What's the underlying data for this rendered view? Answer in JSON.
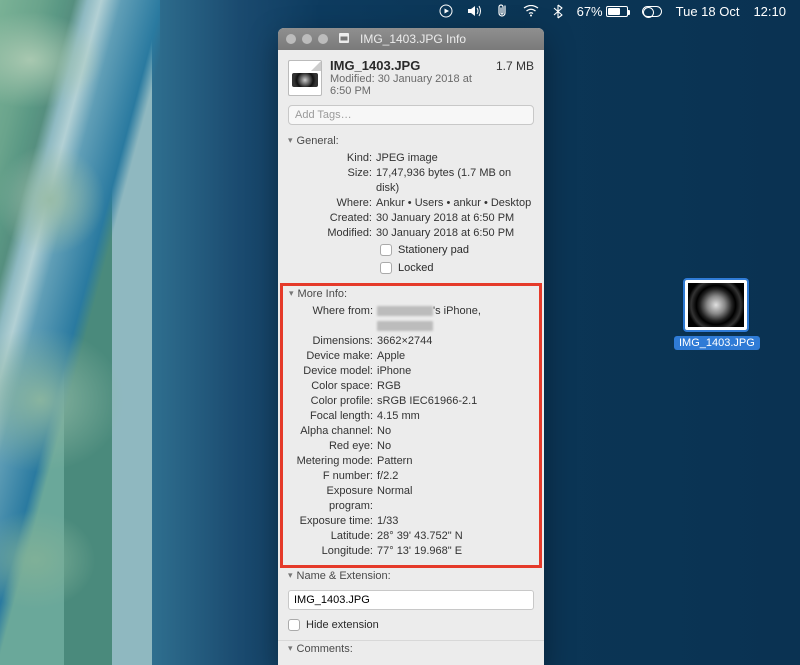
{
  "menubar": {
    "battery_pct": "67%",
    "date": "Tue 18 Oct",
    "time": "12:10"
  },
  "desktop_file": {
    "name": "IMG_1403.JPG"
  },
  "window": {
    "title": "IMG_1403.JPG Info",
    "header": {
      "filename": "IMG_1403.JPG",
      "size": "1.7 MB",
      "modified": "Modified: 30 January 2018 at 6:50 PM"
    },
    "tags_placeholder": "Add Tags…",
    "sections": {
      "general": {
        "title": "General:",
        "kind": "JPEG image",
        "size": "17,47,936 bytes (1.7 MB on disk)",
        "where": "Ankur • Users • ankur • Desktop",
        "created": "30 January 2018 at 6:50 PM",
        "modified": "30 January 2018 at 6:50 PM",
        "stationery": "Stationery pad",
        "locked": "Locked"
      },
      "more_info": {
        "title": "More Info:",
        "where_from_suffix": "'s iPhone,",
        "dimensions": "3662×2744",
        "device_make": "Apple",
        "device_model": "iPhone",
        "color_space": "RGB",
        "color_profile": "sRGB IEC61966-2.1",
        "focal_length": "4.15 mm",
        "alpha_channel": "No",
        "red_eye": "No",
        "metering_mode": "Pattern",
        "f_number": "f/2.2",
        "exposure_program": "Normal",
        "exposure_time": "1/33",
        "latitude": "28° 39' 43.752\" N",
        "longitude": "77° 13' 19.968\" E",
        "labels": {
          "where_from": "Where from:",
          "dimensions": "Dimensions:",
          "device_make": "Device make:",
          "device_model": "Device model:",
          "color_space": "Color space:",
          "color_profile": "Color profile:",
          "focal_length": "Focal length:",
          "alpha_channel": "Alpha channel:",
          "red_eye": "Red eye:",
          "metering_mode": "Metering mode:",
          "f_number": "F number:",
          "exposure_program": "Exposure program:",
          "exposure_time": "Exposure time:",
          "latitude": "Latitude:",
          "longitude": "Longitude:"
        }
      },
      "name_ext": {
        "title": "Name & Extension:",
        "value": "IMG_1403.JPG",
        "hide_extension": "Hide extension"
      },
      "comments": {
        "title": "Comments:"
      }
    },
    "general_labels": {
      "kind": "Kind:",
      "size": "Size:",
      "where": "Where:",
      "created": "Created:",
      "modified": "Modified:"
    }
  }
}
